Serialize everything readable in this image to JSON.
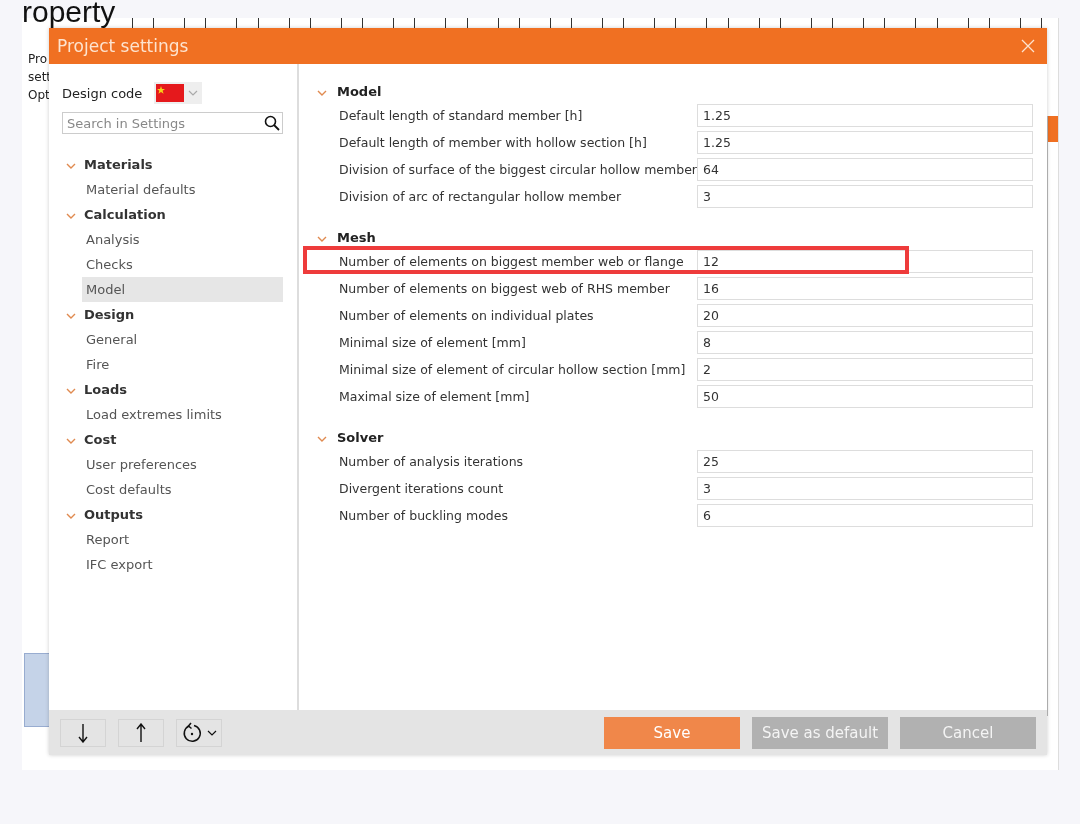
{
  "background": {
    "heading": "roperty",
    "ribbon_labels": [
      "Pro",
      "sett",
      "Opt"
    ]
  },
  "dialog": {
    "title": "Project settings",
    "design_code": {
      "label": "Design code"
    },
    "search": {
      "placeholder": "Search in Settings"
    },
    "tree": [
      {
        "label": "Materials",
        "expanded": true,
        "children": [
          {
            "label": "Material defaults",
            "selected": false
          }
        ]
      },
      {
        "label": "Calculation",
        "expanded": true,
        "children": [
          {
            "label": "Analysis",
            "selected": false
          },
          {
            "label": "Checks",
            "selected": false
          },
          {
            "label": "Model",
            "selected": true
          }
        ]
      },
      {
        "label": "Design",
        "expanded": true,
        "children": [
          {
            "label": "General",
            "selected": false
          },
          {
            "label": "Fire",
            "selected": false
          }
        ]
      },
      {
        "label": "Loads",
        "expanded": true,
        "children": [
          {
            "label": "Load extremes limits",
            "selected": false
          }
        ]
      },
      {
        "label": "Cost",
        "expanded": true,
        "children": [
          {
            "label": "User preferences",
            "selected": false
          },
          {
            "label": "Cost defaults",
            "selected": false
          }
        ]
      },
      {
        "label": "Outputs",
        "expanded": true,
        "children": [
          {
            "label": "Report",
            "selected": false
          },
          {
            "label": "IFC export",
            "selected": false
          }
        ]
      }
    ],
    "sections": [
      {
        "title": "Model",
        "expanded": true,
        "rows": [
          {
            "label": "Default length of standard member [h]",
            "value": "1.25",
            "highlighted": false
          },
          {
            "label": "Default length of member with hollow section [h]",
            "value": "1.25",
            "highlighted": false
          },
          {
            "label": "Division of surface of the biggest circular hollow member",
            "value": "64",
            "highlighted": false
          },
          {
            "label": "Division of arc of rectangular hollow member",
            "value": "3",
            "highlighted": false
          }
        ]
      },
      {
        "title": "Mesh",
        "expanded": true,
        "rows": [
          {
            "label": "Number of elements on biggest member web or flange",
            "value": "12",
            "highlighted": true
          },
          {
            "label": "Number of elements on biggest web of RHS member",
            "value": "16",
            "highlighted": false
          },
          {
            "label": "Number of elements on individual plates",
            "value": "20",
            "highlighted": false
          },
          {
            "label": "Minimal size of element [mm]",
            "value": "8",
            "highlighted": false
          },
          {
            "label": "Minimal size of element of circular hollow section [mm]",
            "value": "2",
            "highlighted": false
          },
          {
            "label": "Maximal size of element [mm]",
            "value": "50",
            "highlighted": false
          }
        ]
      },
      {
        "title": "Solver",
        "expanded": true,
        "rows": [
          {
            "label": "Number of analysis iterations",
            "value": "25",
            "highlighted": false
          },
          {
            "label": "Divergent iterations count",
            "value": "3",
            "highlighted": false
          },
          {
            "label": "Number of buckling modes",
            "value": "6",
            "highlighted": false
          }
        ]
      }
    ],
    "buttons": [
      {
        "label": "Save",
        "kind": "primary"
      },
      {
        "label": "Save as default",
        "kind": "secondary"
      },
      {
        "label": "Cancel",
        "kind": "secondary"
      }
    ]
  }
}
